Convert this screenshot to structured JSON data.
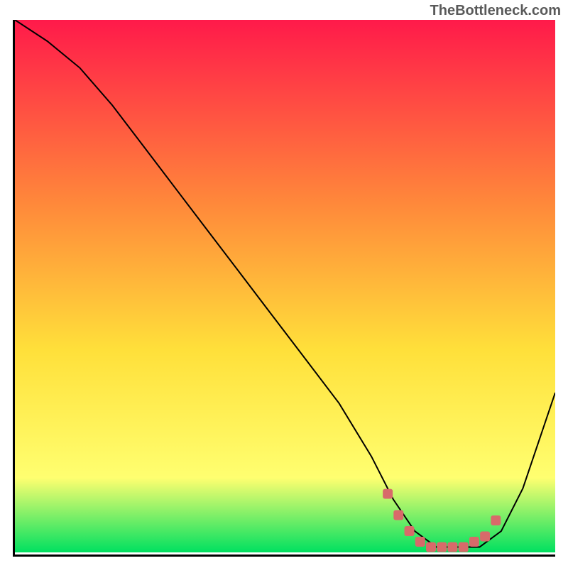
{
  "watermark": "TheBottleneck.com",
  "colors": {
    "gradient_top": "#ff1a4a",
    "gradient_mid1": "#ff8a3a",
    "gradient_mid2": "#ffe03a",
    "gradient_mid3": "#ffff70",
    "gradient_bottom": "#00e060",
    "curve": "#000000",
    "marker": "#d86a6a"
  },
  "chart_data": {
    "type": "line",
    "title": "",
    "xlabel": "",
    "ylabel": "",
    "xlim": [
      0,
      100
    ],
    "ylim": [
      0,
      100
    ],
    "series": [
      {
        "name": "curve",
        "x": [
          0,
          6,
          12,
          18,
          24,
          30,
          36,
          42,
          48,
          54,
          60,
          66,
          70,
          74,
          78,
          82,
          86,
          90,
          94,
          100
        ],
        "y": [
          100,
          96,
          91,
          84,
          76,
          68,
          60,
          52,
          44,
          36,
          28,
          18,
          10,
          4,
          1,
          1,
          1,
          4,
          12,
          30
        ]
      }
    ],
    "markers": {
      "name": "highlight",
      "x": [
        69,
        71,
        73,
        75,
        77,
        79,
        81,
        83,
        85,
        87,
        89
      ],
      "y": [
        11,
        7,
        4,
        2,
        1,
        1,
        1,
        1,
        2,
        3,
        6
      ]
    }
  }
}
